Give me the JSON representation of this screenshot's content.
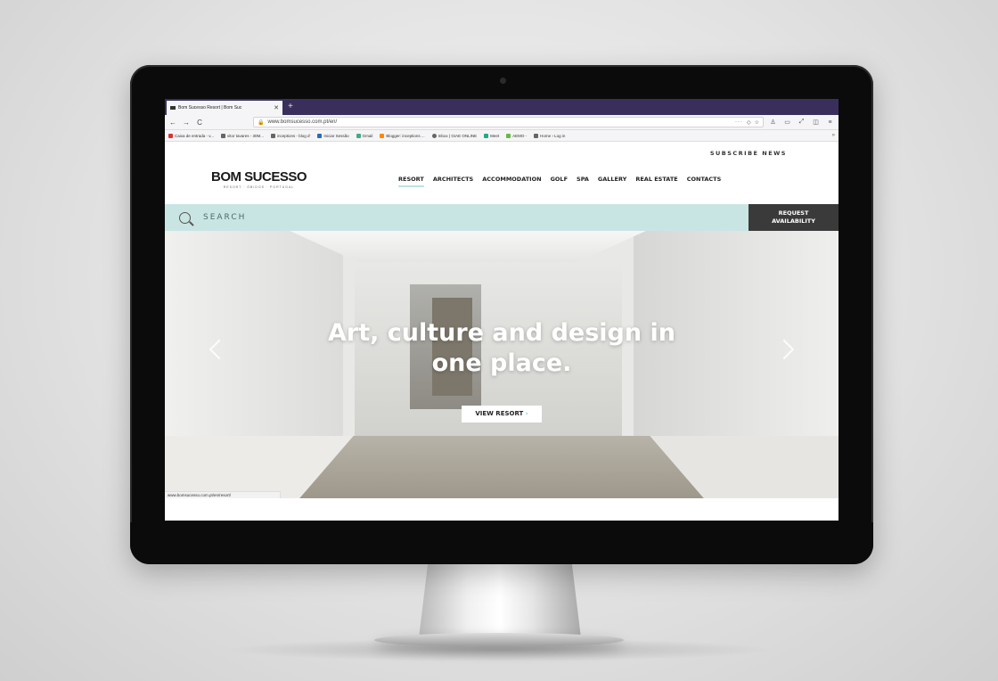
{
  "browser": {
    "tab_title": "Bom Sucesso Resort | Bom Suc",
    "tab_close": "✕",
    "new_tab": "+",
    "back": "←",
    "forward": "→",
    "reload": "C",
    "url": "www.bomsucesso.com.pt/en/",
    "more": "···",
    "bookmarks": [
      "Caixa de entrada - v...",
      "vitor tavares - 30M...",
      "inceptions - blog d'",
      "Iniciar Sessão",
      "Gmail",
      "Blogger: inceptions ...",
      "Inbox | GIAE ONLINE",
      "Meet",
      "AEMO -",
      "Home › Log in"
    ],
    "bookmarks_more": "»",
    "status_url": "www.bomsucesso.com.pt/en/resort/"
  },
  "site": {
    "subscribe": "SUBSCRIBE NEWS",
    "logo_name": "BOM SUCESSO",
    "logo_tag": "RESORT · ÓBIDOS · PORTUGAL",
    "nav": [
      "RESORT",
      "ARCHITECTS",
      "ACCOMMODATION",
      "GOLF",
      "SPA",
      "GALLERY",
      "REAL ESTATE",
      "CONTACTS"
    ],
    "search_label": "SEARCH",
    "request_line1": "REQUEST",
    "request_line2": "AVAILABILITY"
  },
  "hero": {
    "title_line1": "Art, culture and design in",
    "title_line2": "one place.",
    "button": "VIEW RESORT",
    "button_chevron": "›"
  }
}
